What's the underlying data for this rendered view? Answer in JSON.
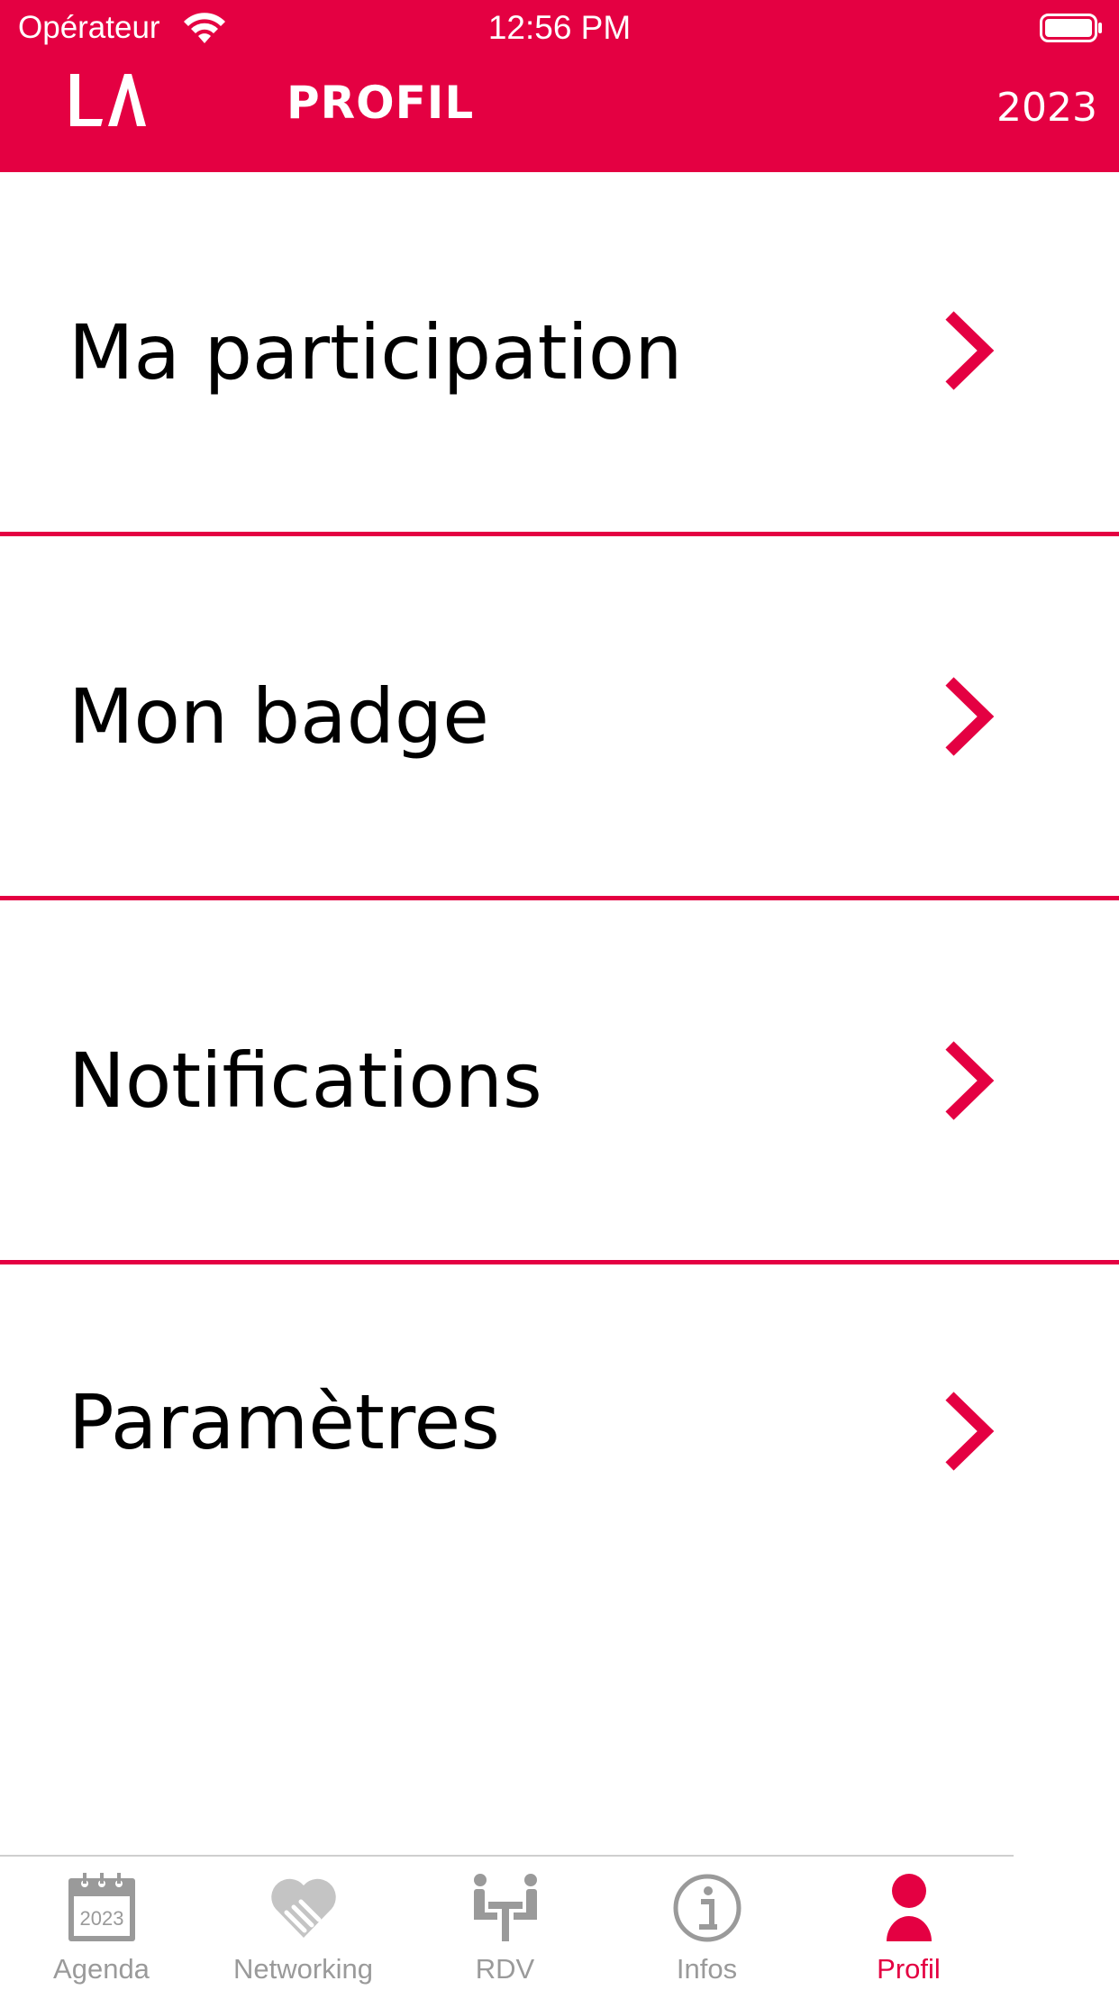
{
  "status_bar": {
    "carrier": "Opérateur",
    "time": "12:56 PM"
  },
  "header": {
    "title": "PROFIL",
    "year": "2023",
    "logo_text": "LA",
    "background": "#e40042"
  },
  "menu": {
    "items": [
      {
        "label": "Ma participation"
      },
      {
        "label": "Mon badge"
      },
      {
        "label": "Notifications"
      },
      {
        "label": "Paramètres"
      }
    ]
  },
  "tabbar": {
    "tabs": [
      {
        "label": "Agenda",
        "icon": "calendar-icon",
        "calendar_year": "2023"
      },
      {
        "label": "Networking",
        "icon": "handshake-heart-icon"
      },
      {
        "label": "RDV",
        "icon": "meeting-table-icon"
      },
      {
        "label": "Infos",
        "icon": "info-icon"
      },
      {
        "label": "Profil",
        "icon": "person-icon",
        "active": true
      }
    ],
    "active_color": "#e40042",
    "inactive_color": "#9a9a9a"
  }
}
